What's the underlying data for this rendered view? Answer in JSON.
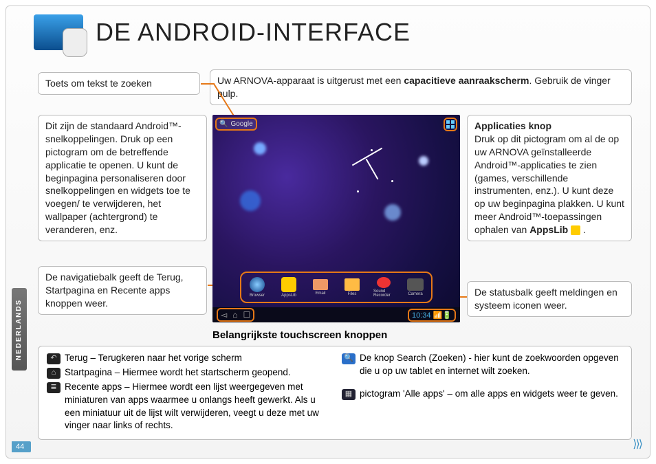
{
  "header": {
    "title": "DE ANDROID-INTERFACE"
  },
  "language_tab": "NEDERLANDS",
  "page_number": "44",
  "callouts": {
    "search_hint": "Toets om tekst te zoeken",
    "touchscreen_intro_pre": "Uw ARNOVA-apparaat is uitgerust met een ",
    "touchscreen_intro_bold": "capacitieve aanraakscherm",
    "touchscreen_intro_post": ". Gebruik de vinger pulp.",
    "shortcuts": "Dit zijn de standaard Android™-snelkoppelingen. Druk op een pictogram om de betreffende applicatie te openen. U kunt de beginpagina personaliseren door snelkoppelingen en widgets toe te voegen/ te verwijderen, het wallpaper (achtergrond) te veranderen, enz.",
    "navbar": "De navigatiebalk geeft de Terug, Startpagina en Recente apps knoppen weer.",
    "apps_heading": "Applicaties knop",
    "apps_body_pre": "Druk op dit pictogram om al de op uw ARNOVA geïnstalleerde Android™-applicaties te zien (games, verschillende instrumenten, enz.). U kunt deze op uw beginpagina plakken. U kunt meer Android™-toepassingen ophalen van ",
    "apps_body_bold": "AppsLib",
    "statusbar": "De statusbalk geeft meldingen en systeem iconen weer."
  },
  "section_heading": "Belangrijkste touchscreen knoppen",
  "buttons": {
    "back": "Terug – Terugkeren naar het vorige scherm",
    "home": "Startpagina – Hiermee wordt het startscherm geopend.",
    "recent": "Recente apps – Hiermee wordt een lijst weergegeven met miniaturen van apps waarmee u onlangs heeft gewerkt. Als u een miniatuur uit de lijst wilt verwijderen, veegt u deze met uw vinger naar links of rechts.",
    "search": "De knop Search (Zoeken) - hier kunt de zoekwoorden opgeven die u op uw tablet en internet wilt zoeken.",
    "all_apps": "pictogram 'Alle apps' – om alle apps en widgets weer te geven."
  },
  "screenshot": {
    "search_label": "Google",
    "dock": [
      "Browser",
      "AppsLib",
      "Email",
      "Files",
      "Sound Recorder",
      "Camera"
    ],
    "clock_time": "10:34"
  }
}
